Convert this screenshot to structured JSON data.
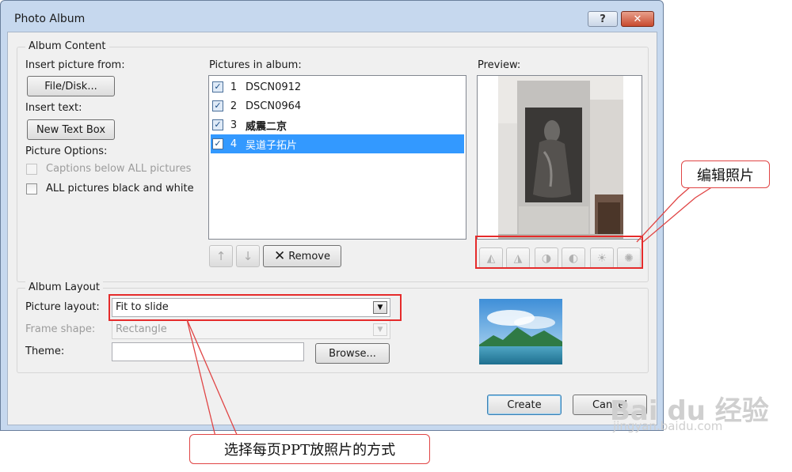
{
  "window": {
    "title": "Photo Album",
    "help_label": "?",
    "close_label": "✕"
  },
  "album_content": {
    "group_label": "Album Content",
    "insert_picture_label": "Insert picture from:",
    "file_disk_button": "File/Disk...",
    "insert_text_label": "Insert text:",
    "new_text_box_button": "New Text Box",
    "picture_options_label": "Picture Options:",
    "captions_below_label": "Captions below ALL pictures",
    "black_white_label": "ALL pictures black and white",
    "pictures_in_album_label": "Pictures in album:",
    "pictures": [
      {
        "num": "1",
        "name": "DSCN0912",
        "checked": true
      },
      {
        "num": "2",
        "name": "DSCN0964",
        "checked": true
      },
      {
        "num": "3",
        "name": "威震二京",
        "checked": true
      },
      {
        "num": "4",
        "name": "吴道子拓片",
        "checked": true
      }
    ],
    "remove_button": "Remove",
    "preview_label": "Preview:"
  },
  "album_layout": {
    "group_label": "Album Layout",
    "picture_layout_label": "Picture layout:",
    "picture_layout_value": "Fit to slide",
    "frame_shape_label": "Frame shape:",
    "frame_shape_value": "Rectangle",
    "theme_label": "Theme:",
    "theme_value": "",
    "browse_button": "Browse..."
  },
  "footer": {
    "create_button": "Create",
    "cancel_button": "Cancel"
  },
  "annotations": {
    "edit_photos_callout": "编辑照片",
    "layout_callout": "选择每页PPT放照片的方式"
  },
  "watermark": {
    "brand": "Bai du 经验",
    "url": "jingyan.baidu.com"
  },
  "colors": {
    "selection": "#3399ff",
    "annotation_red": "#e52b2b",
    "title_bar": "#c6d8ee"
  }
}
